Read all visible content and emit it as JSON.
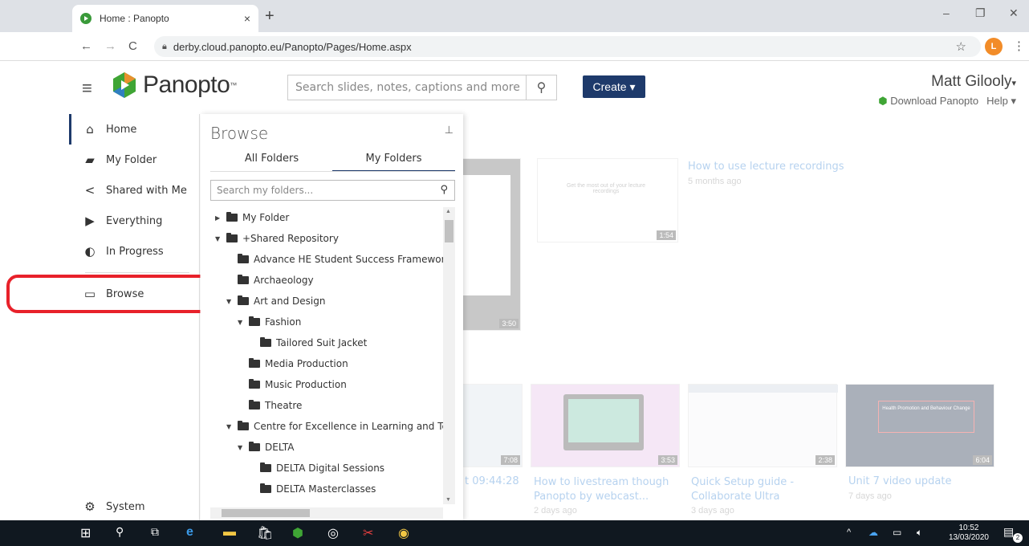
{
  "browser": {
    "tab_title": "Home : Panopto",
    "tab_close": "×",
    "new_tab": "+",
    "url": "derby.cloud.panopto.eu/Panopto/Pages/Home.aspx",
    "profile_initial": "L",
    "minimize": "–",
    "restore": "❐",
    "close": "✕"
  },
  "header": {
    "logo_text": "Panopto",
    "search_placeholder": "Search slides, notes, captions and more",
    "create_label": "Create ▾",
    "user_name": "Matt Gilooly",
    "download_link": "Download Panopto",
    "help_link": "Help ▾"
  },
  "leftnav": {
    "items": [
      {
        "label": "Home"
      },
      {
        "label": "My Folder"
      },
      {
        "label": "Shared with Me"
      },
      {
        "label": "Everything"
      },
      {
        "label": "In Progress"
      },
      {
        "label": "Browse"
      }
    ],
    "system": "System"
  },
  "browse": {
    "title": "Browse",
    "tab_all": "All Folders",
    "tab_mine": "My Folders",
    "search_placeholder": "Search my folders...",
    "tree": [
      {
        "label": "My Folder",
        "expanded": false
      },
      {
        "label": "+Shared Repository",
        "expanded": true
      },
      {
        "label": "Advance HE Student Success Frameworks Pr"
      },
      {
        "label": "Archaeology"
      },
      {
        "label": "Art and Design",
        "expanded": true
      },
      {
        "label": "Fashion",
        "expanded": true
      },
      {
        "label": "Tailored Suit Jacket"
      },
      {
        "label": "Media Production"
      },
      {
        "label": "Music Production"
      },
      {
        "label": "Theatre"
      },
      {
        "label": "Centre for Excellence in Learning and Teach",
        "expanded": true
      },
      {
        "label": "DELTA",
        "expanded": true
      },
      {
        "label": "DELTA Digital Sessions"
      },
      {
        "label": "DELTA Masterclasses"
      }
    ]
  },
  "content": {
    "videos_top": [
      {
        "title": "How to use lecture recordings",
        "sub": "5 months ago",
        "duration": "1:54",
        "thumb_text": "Get the most out of your lecture recordings"
      },
      {
        "duration": "3:50"
      }
    ],
    "videos_bottom": [
      {
        "title_partial": "t 09:44:28",
        "duration": "7:08"
      },
      {
        "title": "How to livestream though Panopto by webcast...",
        "sub": "2 days ago",
        "duration": "3:53"
      },
      {
        "title": "Quick Setup guide - Collaborate Ultra",
        "sub": "3 days ago",
        "duration": "2:38"
      },
      {
        "title": "Unit 7 video update",
        "sub": "7 days ago",
        "duration": "6:04",
        "thumb_text": "Health Promotion and Behaviour Change"
      }
    ]
  },
  "taskbar": {
    "time": "10:52",
    "date": "13/03/2020",
    "notif_count": "2"
  }
}
